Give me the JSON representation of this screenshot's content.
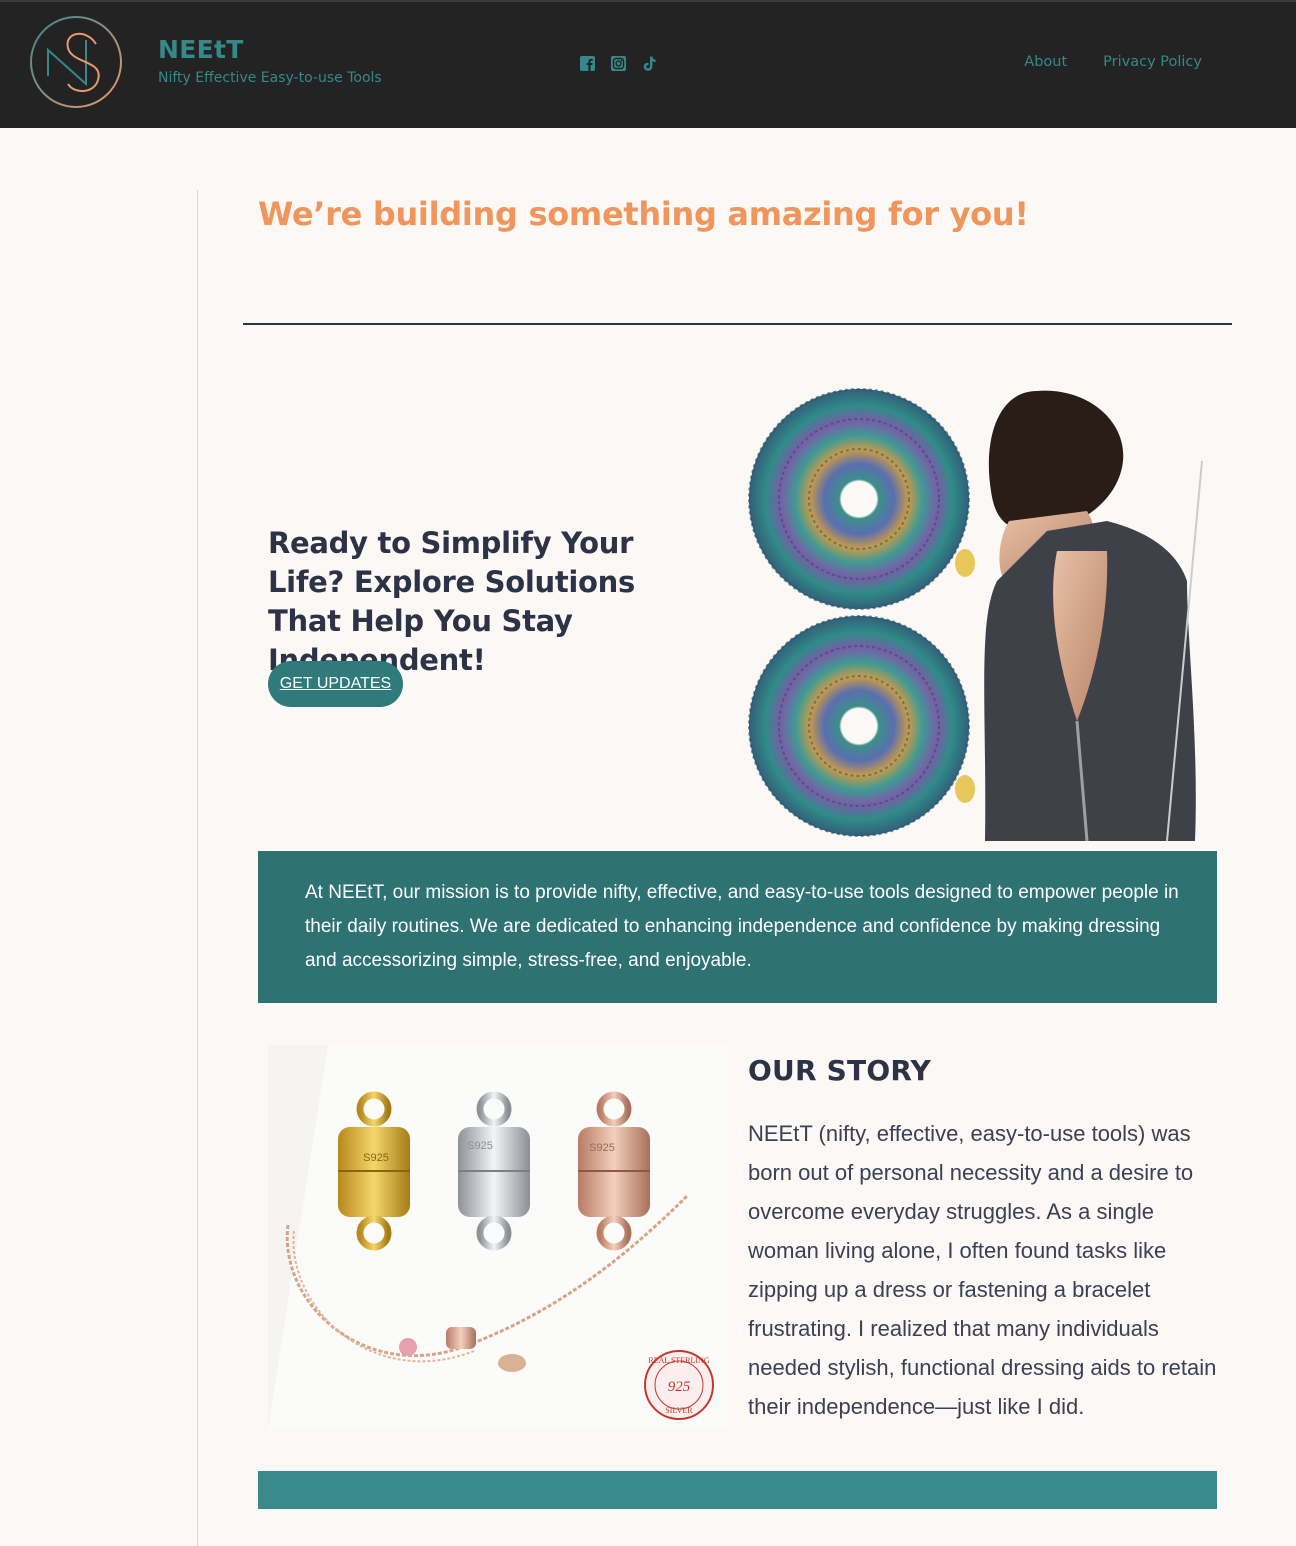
{
  "header": {
    "site_title": "NEEtT",
    "tagline": "Nifty Effective Easy-to-use Tools",
    "socials": [
      {
        "icon": "facebook-icon"
      },
      {
        "icon": "instagram-icon"
      },
      {
        "icon": "tiktok-icon"
      }
    ],
    "nav": [
      {
        "label": "About"
      },
      {
        "label": "Privacy Policy"
      }
    ]
  },
  "main": {
    "headline": "We’re building something amazing for you!",
    "hero": {
      "title": "Ready to Simplify Your Life? Explore Solutions That Help You Stay Independent!",
      "cta_label": "GET UPDATES"
    },
    "mission_text": "At NEEtT, our mission is to provide nifty, effective, and easy-to-use tools designed to empower people in their daily routines. We are dedicated to enhancing independence and confidence by making dressing and accessorizing simple, stress-free, and enjoyable.",
    "story": {
      "title": "OUR STORY",
      "text": "NEEtT (nifty, effective, easy-to-use tools) was born out of personal necessity and a desire to overcome everyday struggles. As a single woman living alone, I often found tasks like zipping up a dress or fastening a bracelet frustrating. I realized that many individuals needed stylish, functional dressing aids to retain their independence—just like I did.",
      "stamp_text": {
        "top": "REAL STERLING",
        "center": "925",
        "bottom": "SILVER"
      },
      "clasp_marks": [
        "S925",
        "S925",
        "S925"
      ]
    }
  },
  "colors": {
    "header_bg": "#232323",
    "brand_teal": "#35898a",
    "accent_orange": "#f0955c",
    "mission_bg": "#2f7273",
    "heading_navy": "#2d3347",
    "page_bg": "#fbf8f5"
  }
}
